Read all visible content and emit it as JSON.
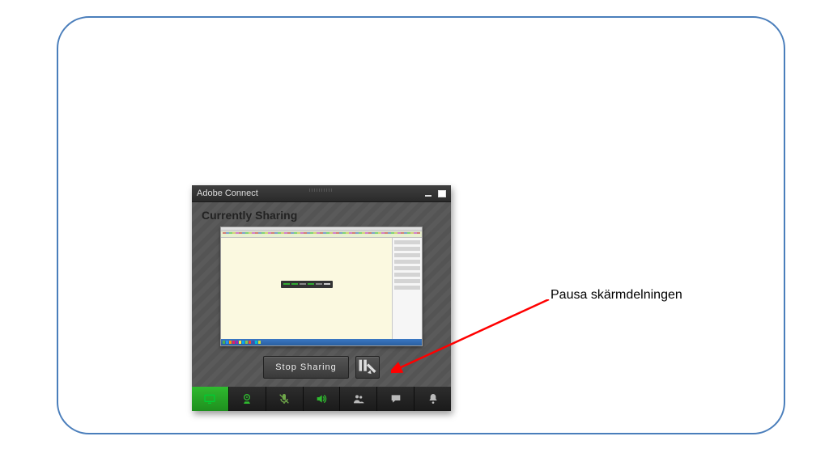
{
  "panel": {
    "title": "Adobe Connect",
    "heading": "Currently Sharing",
    "stop_label": "Stop Sharing"
  },
  "icons": {
    "pause": "pause-annotate-icon",
    "strip": [
      "screen-share-icon",
      "webcam-icon",
      "microphone-muted-icon",
      "speaker-icon",
      "attendees-icon",
      "chat-icon",
      "notification-bell-icon"
    ]
  },
  "colors": {
    "accent_green": "#2fba2f",
    "dim_green": "#6fa84a",
    "grey": "#bababa"
  },
  "annotation": {
    "text": "Pausa skärmdelningen"
  }
}
